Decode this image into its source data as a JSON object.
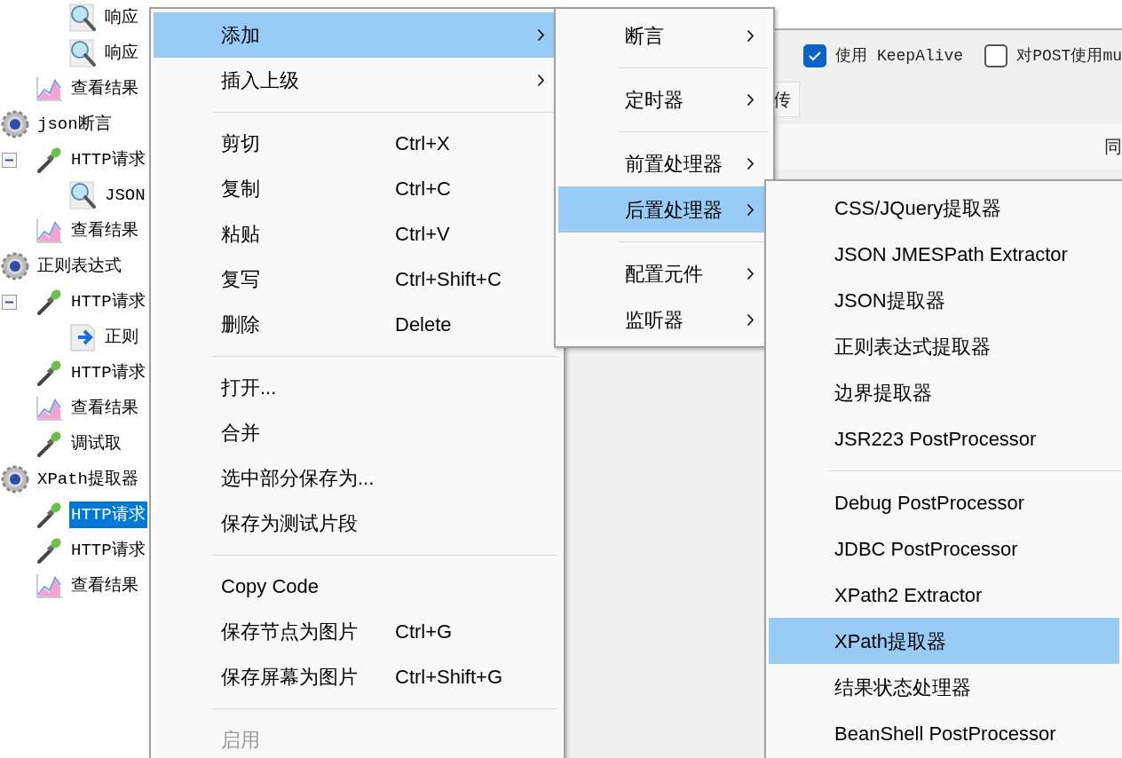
{
  "tree": [
    {
      "children": [
        {
          "children": [
            {
              "label": "响应",
              "kind": "assertion",
              "selected": false
            },
            {
              "label": "响应",
              "kind": "assertion",
              "selected": false
            }
          ]
        },
        {
          "label": "查看结果",
          "kind": "listener",
          "selected": false
        }
      ]
    },
    {
      "label": "json断言",
      "kind": "thread_group",
      "selected": false,
      "children": [
        {
          "label": "HTTP请求",
          "kind": "sampler",
          "selected": false,
          "expanded": true,
          "children": [
            {
              "label": "JSON",
              "kind": "assertion",
              "selected": false
            }
          ]
        },
        {
          "label": "查看结果",
          "kind": "listener",
          "selected": false
        }
      ]
    },
    {
      "label": "正则表达式",
      "kind": "thread_group",
      "selected": false,
      "children": [
        {
          "label": "HTTP请求",
          "kind": "sampler",
          "selected": false,
          "expanded": true,
          "children": [
            {
              "label": "正则",
              "kind": "extractor",
              "selected": false
            }
          ]
        },
        {
          "label": "HTTP请求",
          "kind": "sampler",
          "selected": false
        },
        {
          "label": "查看结果",
          "kind": "listener",
          "selected": false
        },
        {
          "label": "调试取",
          "kind": "sampler",
          "selected": false
        }
      ]
    },
    {
      "label": "XPath提取器",
      "kind": "thread_group",
      "selected": false,
      "children": [
        {
          "label": "HTTP请求",
          "kind": "sampler",
          "selected": true
        },
        {
          "label": "HTTP请求",
          "kind": "sampler",
          "selected": false
        },
        {
          "label": "查看结果",
          "kind": "listener",
          "selected": false
        }
      ]
    }
  ],
  "request_panel": {
    "checkboxes": [
      {
        "label": "使用 KeepAlive",
        "checked": true
      },
      {
        "label": "对POST使用mu",
        "checked": false
      }
    ],
    "tab": "传",
    "column_header": "同"
  },
  "context_menu": [
    {
      "kind": "item",
      "label": "添加",
      "submenu": true,
      "selected": true,
      "disabled": false
    },
    {
      "kind": "item",
      "label": "插入上级",
      "submenu": true,
      "selected": false,
      "disabled": false
    },
    {
      "kind": "separator"
    },
    {
      "kind": "item",
      "label": "剪切",
      "shortcut": "Ctrl+X",
      "submenu": false,
      "selected": false,
      "disabled": false
    },
    {
      "kind": "item",
      "label": "复制",
      "shortcut": "Ctrl+C",
      "submenu": false,
      "selected": false,
      "disabled": false
    },
    {
      "kind": "item",
      "label": "粘贴",
      "shortcut": "Ctrl+V",
      "submenu": false,
      "selected": false,
      "disabled": false
    },
    {
      "kind": "item",
      "label": "复写",
      "shortcut": "Ctrl+Shift+C",
      "submenu": false,
      "selected": false,
      "disabled": false
    },
    {
      "kind": "item",
      "label": "删除",
      "shortcut": "Delete",
      "submenu": false,
      "selected": false,
      "disabled": false
    },
    {
      "kind": "separator"
    },
    {
      "kind": "item",
      "label": "打开...",
      "submenu": false,
      "selected": false,
      "disabled": false
    },
    {
      "kind": "item",
      "label": "合并",
      "submenu": false,
      "selected": false,
      "disabled": false
    },
    {
      "kind": "item",
      "label": "选中部分保存为...",
      "submenu": false,
      "selected": false,
      "disabled": false
    },
    {
      "kind": "item",
      "label": "保存为测试片段",
      "submenu": false,
      "selected": false,
      "disabled": false
    },
    {
      "kind": "separator"
    },
    {
      "kind": "item",
      "label": "Copy Code",
      "submenu": false,
      "selected": false,
      "disabled": false
    },
    {
      "kind": "item",
      "label": "保存节点为图片",
      "shortcut": "Ctrl+G",
      "submenu": false,
      "selected": false,
      "disabled": false
    },
    {
      "kind": "item",
      "label": "保存屏幕为图片",
      "shortcut": "Ctrl+Shift+G",
      "submenu": false,
      "selected": false,
      "disabled": false
    },
    {
      "kind": "separator"
    },
    {
      "kind": "item",
      "label": "启用",
      "submenu": false,
      "selected": false,
      "disabled": true
    }
  ],
  "add_submenu": [
    {
      "kind": "item",
      "label": "断言",
      "submenu": true,
      "selected": false
    },
    {
      "kind": "separator"
    },
    {
      "kind": "item",
      "label": "定时器",
      "submenu": true,
      "selected": false
    },
    {
      "kind": "separator"
    },
    {
      "kind": "item",
      "label": "前置处理器",
      "submenu": true,
      "selected": false
    },
    {
      "kind": "item",
      "label": "后置处理器",
      "submenu": true,
      "selected": true
    },
    {
      "kind": "separator"
    },
    {
      "kind": "item",
      "label": "配置元件",
      "submenu": true,
      "selected": false
    },
    {
      "kind": "item",
      "label": "监听器",
      "submenu": true,
      "selected": false
    }
  ],
  "postprocessor_submenu": [
    {
      "kind": "item",
      "label": "CSS/JQuery提取器",
      "selected": false
    },
    {
      "kind": "item",
      "label": "JSON JMESPath Extractor",
      "selected": false
    },
    {
      "kind": "item",
      "label": "JSON提取器",
      "selected": false
    },
    {
      "kind": "item",
      "label": "正则表达式提取器",
      "selected": false
    },
    {
      "kind": "item",
      "label": "边界提取器",
      "selected": false
    },
    {
      "kind": "item",
      "label": "JSR223 PostProcessor",
      "selected": false
    },
    {
      "kind": "separator"
    },
    {
      "kind": "item",
      "label": "Debug PostProcessor",
      "selected": false
    },
    {
      "kind": "item",
      "label": "JDBC PostProcessor",
      "selected": false
    },
    {
      "kind": "item",
      "label": "XPath2 Extractor",
      "selected": false
    },
    {
      "kind": "item",
      "label": "XPath提取器",
      "selected": true
    },
    {
      "kind": "item",
      "label": "结果状态处理器",
      "selected": false
    },
    {
      "kind": "item",
      "label": "BeanShell PostProcessor",
      "selected": false
    }
  ]
}
